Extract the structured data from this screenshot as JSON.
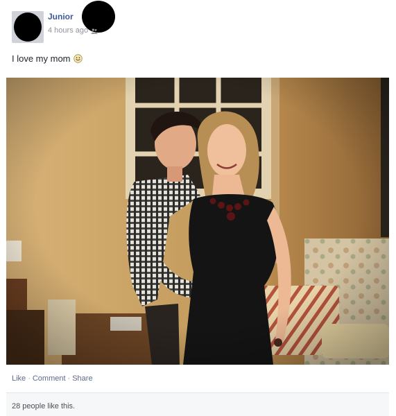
{
  "post": {
    "author_name": "Junior",
    "timestamp": "4 hours ago",
    "audience_icon": "people-icon",
    "status_text": "I love my mom",
    "emoji_icon": "smile-icon",
    "photo": {
      "description_icon": "photo-image"
    }
  },
  "actions": {
    "like_label": "Like",
    "comment_label": "Comment",
    "share_label": "Share",
    "separator": "·"
  },
  "likes_summary": "28 people like this.",
  "colors": {
    "link": "#3b5998",
    "muted": "#90949c",
    "text": "#1d2129"
  }
}
